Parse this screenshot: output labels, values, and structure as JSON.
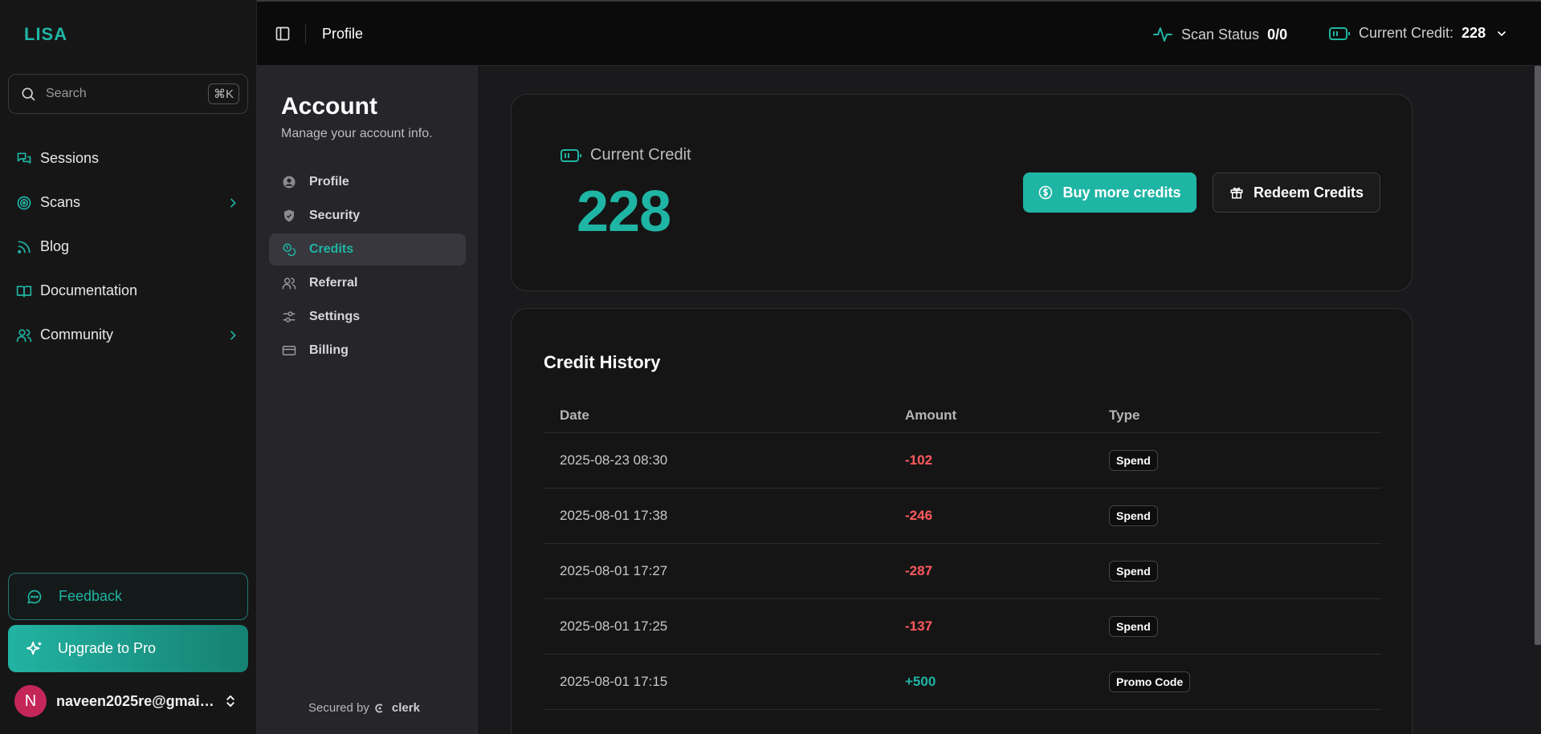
{
  "sidebar": {
    "brand": "LISA",
    "search_placeholder": "Search",
    "search_shortcut": "⌘K",
    "items": [
      {
        "label": "Sessions",
        "icon": "chat-icon"
      },
      {
        "label": "Scans",
        "icon": "target-icon"
      },
      {
        "label": "Blog",
        "icon": "rss-icon"
      },
      {
        "label": "Documentation",
        "icon": "book-icon"
      },
      {
        "label": "Community",
        "icon": "users-icon"
      }
    ],
    "feedback_label": "Feedback",
    "upgrade_label": "Upgrade to Pro",
    "user": {
      "initial": "N",
      "email": "naveen2025re@gmail...."
    }
  },
  "header": {
    "title": "Profile",
    "scan_status_label": "Scan Status",
    "scan_status_value": "0/0",
    "credit_label": "Current Credit:",
    "credit_value": "228"
  },
  "account": {
    "title": "Account",
    "subtitle": "Manage your account info.",
    "items": [
      {
        "label": "Profile",
        "icon": "user-circle-icon"
      },
      {
        "label": "Security",
        "icon": "shield-icon"
      },
      {
        "label": "Credits",
        "icon": "coins-icon",
        "active": true
      },
      {
        "label": "Referral",
        "icon": "users-icon"
      },
      {
        "label": "Settings",
        "icon": "sliders-icon"
      },
      {
        "label": "Billing",
        "icon": "credit-card-icon"
      }
    ],
    "secured_label": "Secured by",
    "secured_brand": "clerk"
  },
  "credit": {
    "label": "Current Credit",
    "value": "228",
    "buy_label": "Buy more credits",
    "redeem_label": "Redeem Credits"
  },
  "history": {
    "title": "Credit History",
    "columns": [
      "Date",
      "Amount",
      "Type"
    ],
    "rows": [
      {
        "date": "2025-08-23 08:30",
        "amount": "-102",
        "type": "Spend"
      },
      {
        "date": "2025-08-01 17:38",
        "amount": "-246",
        "type": "Spend"
      },
      {
        "date": "2025-08-01 17:27",
        "amount": "-287",
        "type": "Spend"
      },
      {
        "date": "2025-08-01 17:25",
        "amount": "-137",
        "type": "Spend"
      },
      {
        "date": "2025-08-01 17:15",
        "amount": "+500",
        "type": "Promo Code"
      }
    ]
  },
  "colors": {
    "accent": "#1fb5a4",
    "negative": "#ff5a5f",
    "avatar": "#c4265a"
  }
}
